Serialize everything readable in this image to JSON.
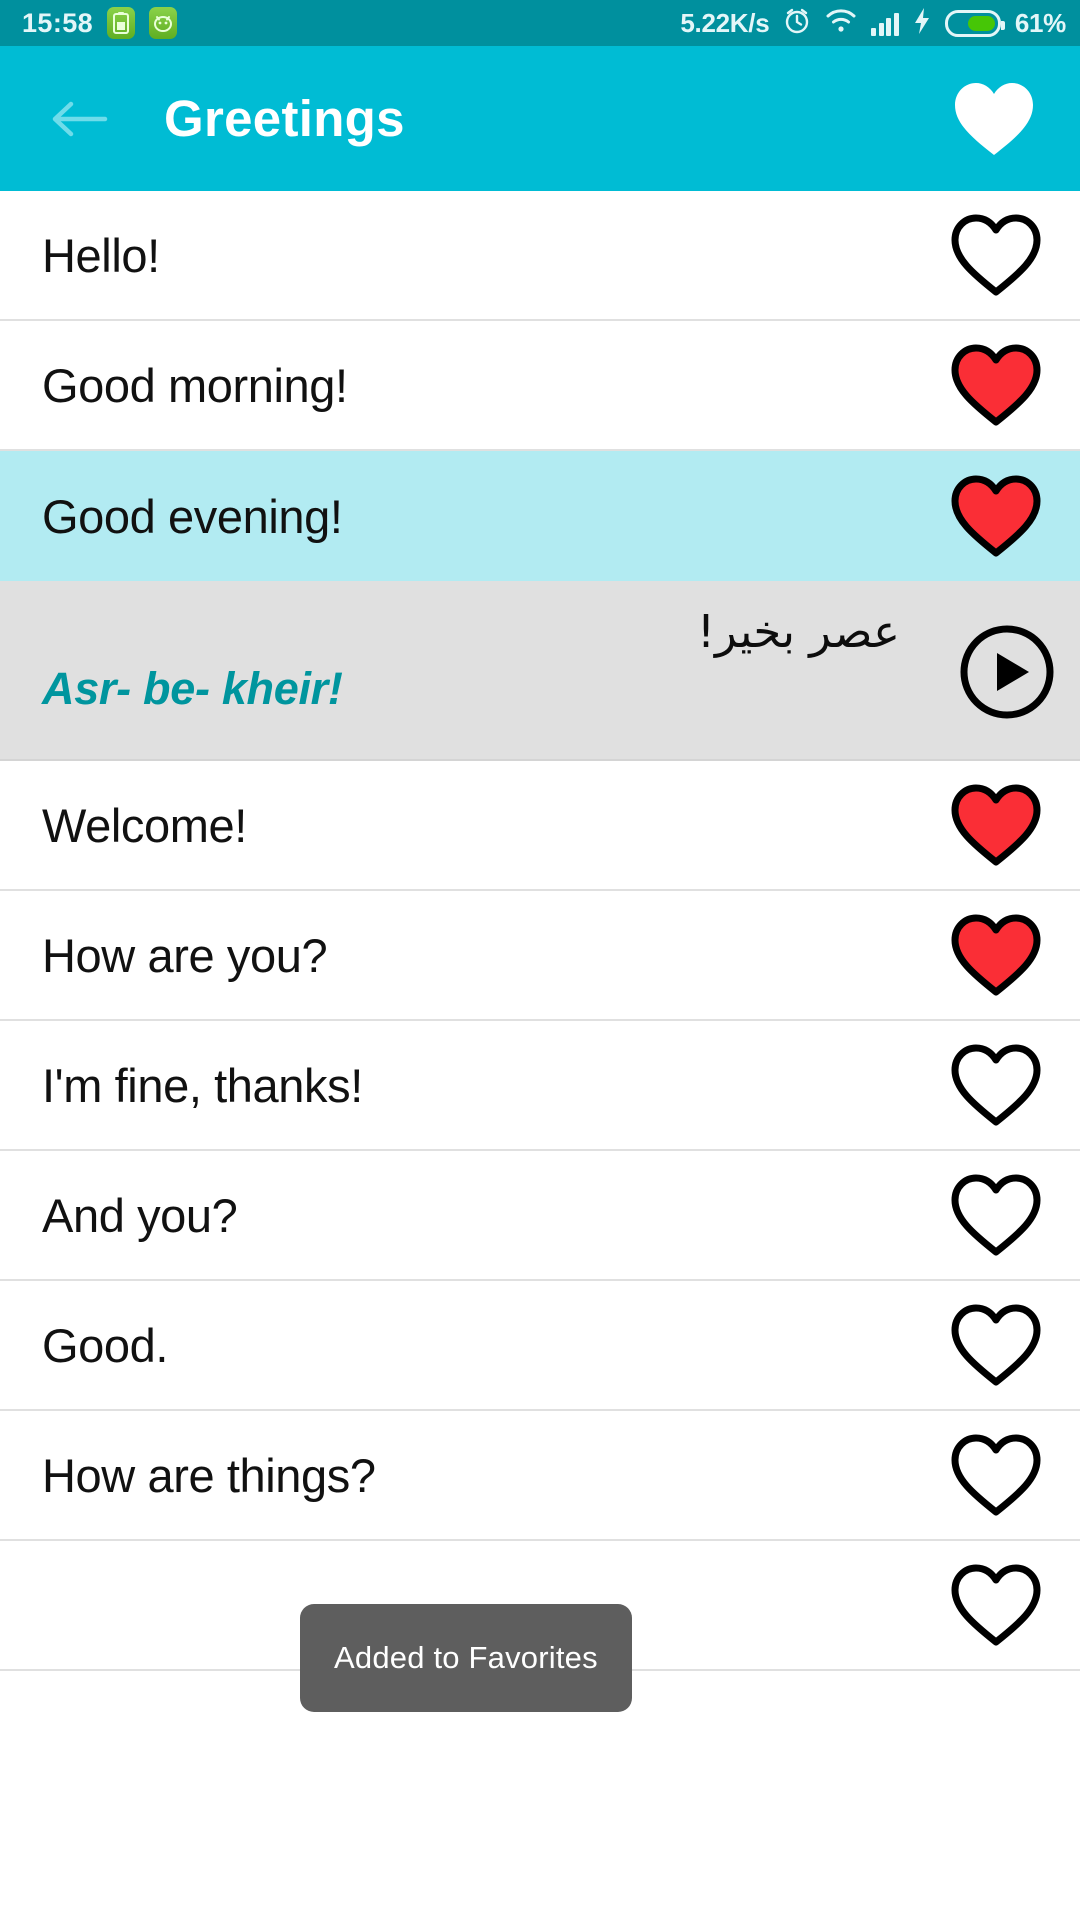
{
  "statusbar": {
    "time": "15:58",
    "network_speed": "5.22K/s",
    "battery_percent": "61%",
    "icons": [
      "battery-saver-icon",
      "android-robot-icon",
      "alarm-icon",
      "wifi-icon",
      "signal-icon",
      "charging-bolt-icon",
      "battery-icon"
    ],
    "colors": {
      "background": "#00909e",
      "text": "#e3f6f8",
      "battery_fill": "#46c606"
    }
  },
  "appbar": {
    "title": "Greetings",
    "back_icon": "arrow-left-icon",
    "favorite_icon": "heart-filled-icon",
    "colors": {
      "background": "#00bcd4",
      "text": "#ffffff"
    }
  },
  "list": {
    "rows": [
      {
        "text": "Hello!",
        "favorited": false,
        "selected": false
      },
      {
        "text": "Good morning!",
        "favorited": true,
        "selected": false
      },
      {
        "text": "Good evening!",
        "favorited": true,
        "selected": true
      },
      {
        "text": "Welcome!",
        "favorited": true,
        "selected": false
      },
      {
        "text": "How are you?",
        "favorited": true,
        "selected": false
      },
      {
        "text": "I'm fine, thanks!",
        "favorited": false,
        "selected": false
      },
      {
        "text": "And you?",
        "favorited": false,
        "selected": false
      },
      {
        "text": "Good.",
        "favorited": false,
        "selected": false
      },
      {
        "text": "How are things?",
        "favorited": false,
        "selected": false
      }
    ]
  },
  "detail": {
    "native_text": "عصر بخیر!",
    "transliteration": "Asr- be- kheir!",
    "play_icon": "play-circle-icon",
    "colors": {
      "background": "#e0e0e0",
      "transliteration": "#00959e"
    }
  },
  "toast": {
    "message": "Added to Favorites",
    "colors": {
      "background": "#5e5e5e",
      "text": "#ffffff"
    }
  },
  "colors": {
    "heart_filled": "#fa2e36",
    "heart_outline": "#000000",
    "row_selected": "#b2ebf2",
    "divider": "#e0e0e0"
  }
}
